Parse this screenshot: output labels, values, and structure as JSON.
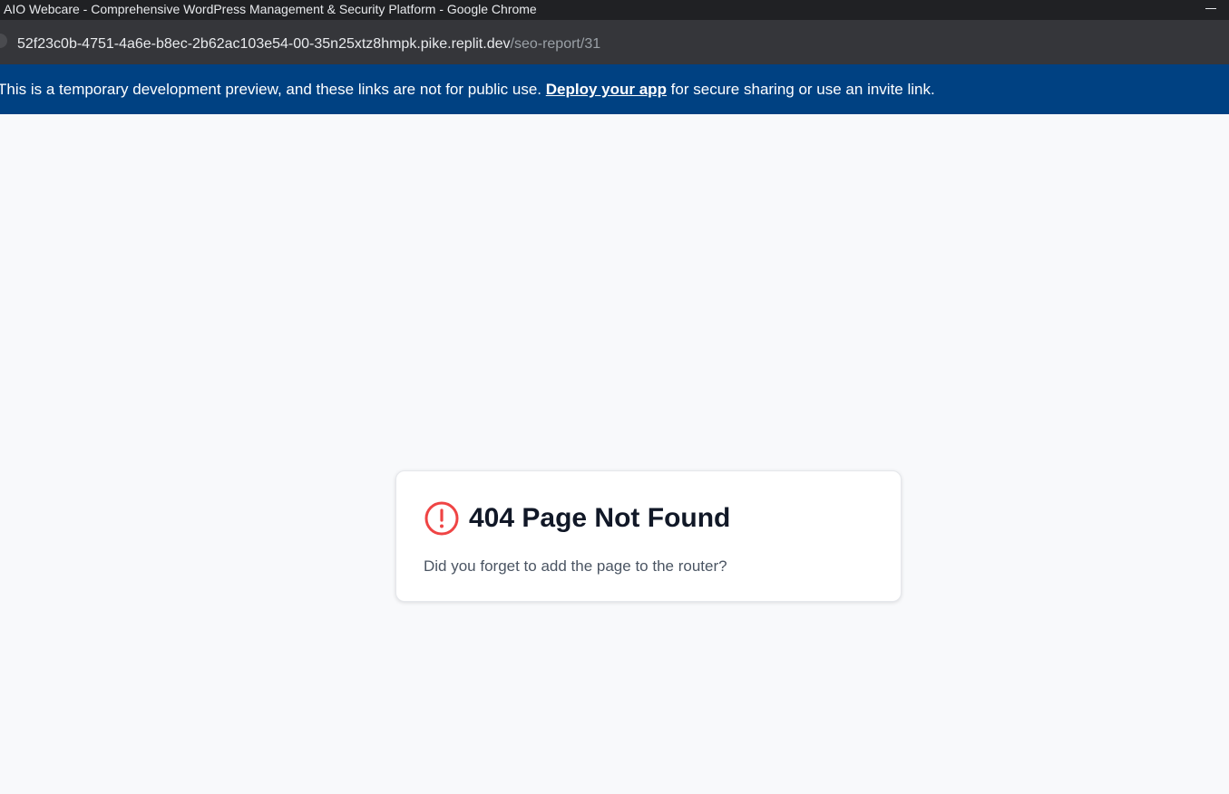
{
  "window": {
    "title": "AIO Webcare - Comprehensive WordPress Management & Security Platform - Google Chrome"
  },
  "addressbar": {
    "host": "52f23c0b-4751-4a6e-b8ec-2b62ac103e54-00-35n25xtz8hmpk.pike.replit.dev",
    "path": "/seo-report/31"
  },
  "banner": {
    "text_before": "This is a temporary development preview, and these links are not for public use. ",
    "link_label": "Deploy your app",
    "text_after": " for secure sharing or use an invite link."
  },
  "error_card": {
    "icon": "alert-circle-icon",
    "title": "404 Page Not Found",
    "description": "Did you forget to add the page to the router?"
  },
  "colors": {
    "banner_bg": "#004182",
    "alert_red": "#ef4444",
    "page_bg": "#f8f9fb"
  }
}
